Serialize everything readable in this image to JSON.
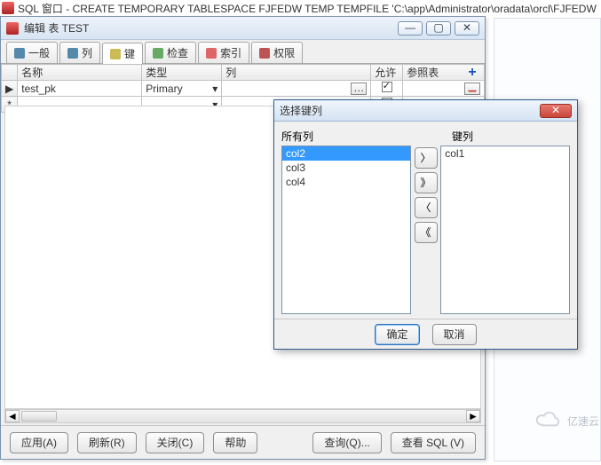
{
  "back_title": {
    "text": "SQL 窗口 - CREATE TEMPORARY TABLESPACE FJFEDW TEMP TEMPFILE 'C:\\app\\Administrator\\oradata\\orcl\\FJFEDW"
  },
  "window": {
    "title": "编辑 表 TEST",
    "min": "—",
    "max": "▢",
    "close": "✕"
  },
  "tabs": [
    {
      "label": "一般"
    },
    {
      "label": "列"
    },
    {
      "label": "键",
      "active": true
    },
    {
      "label": "检查"
    },
    {
      "label": "索引"
    },
    {
      "label": "权限"
    }
  ],
  "grid": {
    "headers": [
      "名称",
      "类型",
      "列",
      "允许",
      "参照表"
    ],
    "rows": [
      {
        "marker": "▶",
        "name": "test_pk",
        "type": "Primary",
        "cols": "",
        "allow": true,
        "ref": ""
      },
      {
        "marker": "*",
        "name": "",
        "type": "",
        "cols": "",
        "allow_gray": true,
        "ref": ""
      }
    ]
  },
  "side": {
    "plus": "+",
    "minus": "−"
  },
  "dialog": {
    "title": "选择键列",
    "left_label": "所有列",
    "right_label": "键列",
    "all_cols": [
      "col2",
      "col3",
      "col4"
    ],
    "selected_all": "col2",
    "key_cols": [
      "col1"
    ],
    "mover": {
      "r": "〉",
      "rr": "》",
      "l": "〈",
      "ll": "《"
    },
    "ok": "确定",
    "cancel": "取消"
  },
  "footer": {
    "apply": "应用(A)",
    "refresh": "刷新(R)",
    "close": "关闭(C)",
    "help": "帮助",
    "query": "查询(Q)...",
    "viewsql": "查看 SQL (V)"
  },
  "scroll": {
    "left": "◄",
    "right": "►"
  },
  "watermark": "亿速云"
}
